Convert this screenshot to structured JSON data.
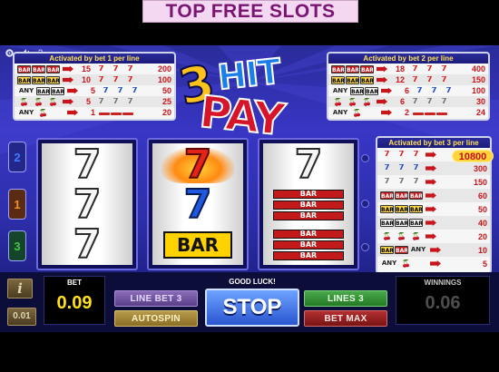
{
  "banner": {
    "text": "TOP FREE SLOTS"
  },
  "topbar": {
    "icons": [
      "settings-icon",
      "sound-icon",
      "help-icon"
    ],
    "help_glyph": "?"
  },
  "logo": {
    "number": "3",
    "word1": "HIT",
    "word2": "PAY"
  },
  "paytable1": {
    "heading": "Activated by bet 1 per line",
    "rows": [
      {
        "symbols": [
          "BAR",
          "BAR",
          "BAR"
        ],
        "types": [
          "bar3",
          "bar3",
          "bar3"
        ],
        "mult": "15",
        "prize": "200"
      },
      {
        "symbols": [
          "BAR",
          "BAR",
          "BAR"
        ],
        "types": [
          "bar2",
          "bar2",
          "bar2"
        ],
        "mult": "10",
        "prize": "100"
      },
      {
        "symbols": [
          "ANY",
          "BAR",
          "BAR"
        ],
        "types": [
          "any",
          "bar1",
          "bar1"
        ],
        "mult": "5",
        "prize": "50"
      },
      {
        "symbols": [
          "🍒",
          "🍒",
          "🍒"
        ],
        "types": [
          "ch",
          "ch",
          "ch"
        ],
        "mult": "5",
        "prize": "25"
      },
      {
        "symbols": [
          "ANY",
          "🍒",
          ""
        ],
        "types": [
          "any",
          "ch",
          "none"
        ],
        "mult": "1",
        "prize": "20"
      }
    ],
    "right_symbols": [
      [
        "7",
        "7",
        "7"
      ],
      [
        "7",
        "7",
        "7"
      ],
      [
        "7",
        "7",
        "7"
      ],
      [
        "7",
        "7",
        "7"
      ],
      [
        "—",
        "—",
        "—"
      ]
    ],
    "right_types": [
      [
        "s7r",
        "s7r",
        "s7r"
      ],
      [
        "s7r",
        "s7r",
        "s7r"
      ],
      [
        "s7b",
        "s7b",
        "s7b"
      ],
      [
        "s7w",
        "s7w",
        "s7w"
      ],
      [
        "dash",
        "dash",
        "dash"
      ]
    ]
  },
  "paytable2": {
    "heading": "Activated by bet 2 per line",
    "rows": [
      {
        "symbols": [
          "BAR",
          "BAR",
          "BAR"
        ],
        "types": [
          "bar3",
          "bar3",
          "bar3"
        ],
        "mult": "18",
        "prize": "400"
      },
      {
        "symbols": [
          "BAR",
          "BAR",
          "BAR"
        ],
        "types": [
          "bar2",
          "bar2",
          "bar2"
        ],
        "mult": "12",
        "prize": "150"
      },
      {
        "symbols": [
          "ANY",
          "BAR",
          "BAR"
        ],
        "types": [
          "any",
          "bar1",
          "bar1"
        ],
        "mult": "6",
        "prize": "100"
      },
      {
        "symbols": [
          "🍒",
          "🍒",
          "🍒"
        ],
        "types": [
          "ch",
          "ch",
          "ch"
        ],
        "mult": "6",
        "prize": "30"
      },
      {
        "symbols": [
          "ANY",
          "🍒",
          ""
        ],
        "types": [
          "any",
          "ch",
          "none"
        ],
        "mult": "2",
        "prize": "24"
      }
    ],
    "right_symbols": [
      [
        "7",
        "7",
        "7"
      ],
      [
        "7",
        "7",
        "7"
      ],
      [
        "7",
        "7",
        "7"
      ],
      [
        "7",
        "7",
        "7"
      ],
      [
        "—",
        "—",
        "—"
      ]
    ],
    "right_types": [
      [
        "s7r",
        "s7r",
        "s7r"
      ],
      [
        "s7r",
        "s7r",
        "s7r"
      ],
      [
        "s7b",
        "s7b",
        "s7b"
      ],
      [
        "s7w",
        "s7w",
        "s7w"
      ],
      [
        "dash",
        "dash",
        "dash"
      ]
    ]
  },
  "paytable3": {
    "heading": "Activated by bet 3 per line",
    "bonus": "10800",
    "rows": [
      {
        "symbols": [
          "7",
          "7",
          "7"
        ],
        "types": [
          "s7r",
          "s7r",
          "s7r"
        ],
        "prize": ""
      },
      {
        "symbols": [
          "7",
          "7",
          "7"
        ],
        "types": [
          "s7b",
          "s7b",
          "s7b"
        ],
        "prize": "300"
      },
      {
        "symbols": [
          "7",
          "7",
          "7"
        ],
        "types": [
          "s7w",
          "s7w",
          "s7w"
        ],
        "prize": "150"
      },
      {
        "symbols": [
          "BAR",
          "BAR",
          "BAR"
        ],
        "types": [
          "bar3",
          "bar3",
          "bar3"
        ],
        "prize": "60"
      },
      {
        "symbols": [
          "BAR",
          "BAR",
          "BAR"
        ],
        "types": [
          "bar2",
          "bar2",
          "bar2"
        ],
        "prize": "50"
      },
      {
        "symbols": [
          "BAR",
          "BAR",
          "BAR"
        ],
        "types": [
          "bar1",
          "bar1",
          "bar1"
        ],
        "prize": "40"
      },
      {
        "symbols": [
          "🍒",
          "🍒",
          "🍒"
        ],
        "types": [
          "ch",
          "ch",
          "ch"
        ],
        "prize": "20"
      },
      {
        "symbols": [
          "BAR",
          "BAR",
          "ANY"
        ],
        "types": [
          "bar2",
          "bar3",
          "any"
        ],
        "prize": "10"
      },
      {
        "symbols": [
          "ANY",
          "🍒",
          ""
        ],
        "types": [
          "any",
          "ch",
          "none"
        ],
        "prize": "5"
      }
    ],
    "mid_symbols": [
      "ANY 🍒"
    ]
  },
  "lines": [
    {
      "number": "2",
      "color": "#1f59e0"
    },
    {
      "number": "1",
      "color": "#d97a1a"
    },
    {
      "number": "3",
      "color": "#3aa83a"
    }
  ],
  "reels": {
    "reel1": [
      "white-seven",
      "white-seven",
      "white-seven"
    ],
    "reel2": [
      "red-seven",
      "blue-seven",
      "bar"
    ],
    "reel3": [
      "white-seven",
      "triple-bar",
      "triple-bar"
    ],
    "seven_glyph": "7",
    "bar_text": "BAR"
  },
  "controls": {
    "info_label": "i",
    "coin_value": "0.01",
    "bet_label": "BET",
    "bet_value": "0.09",
    "line_bet_label": "LINE BET 3",
    "autospin_label": "AUTOSPIN",
    "good_luck": "GOOD LUCK!",
    "stop_label": "STOP",
    "lines_label": "LINES 3",
    "bet_max_label": "BET MAX",
    "winnings_label": "WINNINGS",
    "winnings_value": "0.06"
  }
}
